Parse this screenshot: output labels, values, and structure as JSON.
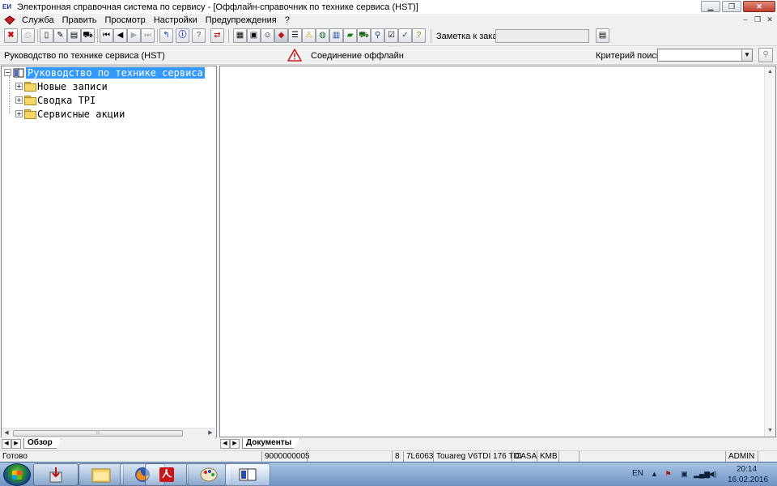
{
  "window": {
    "app_icon": "EИ",
    "title": "Электронная справочная система по сервису - [Оффлайн-справочник по технике сервиса (HST)]"
  },
  "menu": [
    "Служба",
    "Править",
    "Просмотр",
    "Настройки",
    "Предупреждения",
    "?"
  ],
  "toolbar": {
    "order_label": "Заметка к заказу:",
    "order_value": "",
    "icons": [
      "stop-icon",
      "print-icon",
      "new-document-icon",
      "edit-icon",
      "document-icon",
      "car-icon",
      "first-record-icon",
      "previous-record-icon",
      "next-record-icon",
      "last-record-icon",
      "up-level-icon",
      "info-icon",
      "help-icon",
      "swap-icon",
      "manual-icon",
      "catalog-icon",
      "person-icon",
      "book-icon",
      "list-icon",
      "warning-icon",
      "globe-icon",
      "clipboard-icon",
      "note-icon",
      "vehicle-icon",
      "user-search-icon",
      "checklist-icon",
      "diagnostics-icon",
      "help-page-icon",
      "order-notes-icon"
    ]
  },
  "infobar": {
    "panel_title": "Руководство по технике сервиса (HST)",
    "connection_status": "Соединение оффлайн",
    "search_label": "Критерий поиска:",
    "search_value": ""
  },
  "tree": {
    "root": "Руководство по технике сервиса",
    "children": [
      "Новые записи",
      "Сводка TPI",
      "Сервисные акции"
    ]
  },
  "tabs": {
    "left": "Обзор",
    "right": "Документы"
  },
  "status": {
    "ready": "Готово",
    "order_number": "9000000005",
    "field_1": "8",
    "code": "7L6063",
    "vehicle": "Touareg V6TDI 176 TDI",
    "engine": "CASA",
    "gearbox": "KMB",
    "user": "ADMIN"
  },
  "taskbar": {
    "language": "EN",
    "time": "20:14",
    "date": "16.02.2016",
    "items": [
      "installer-icon",
      "file-explorer-icon",
      "firefox-icon",
      "pdf-reader-icon",
      "paint-icon",
      "elsa-app-icon"
    ]
  }
}
